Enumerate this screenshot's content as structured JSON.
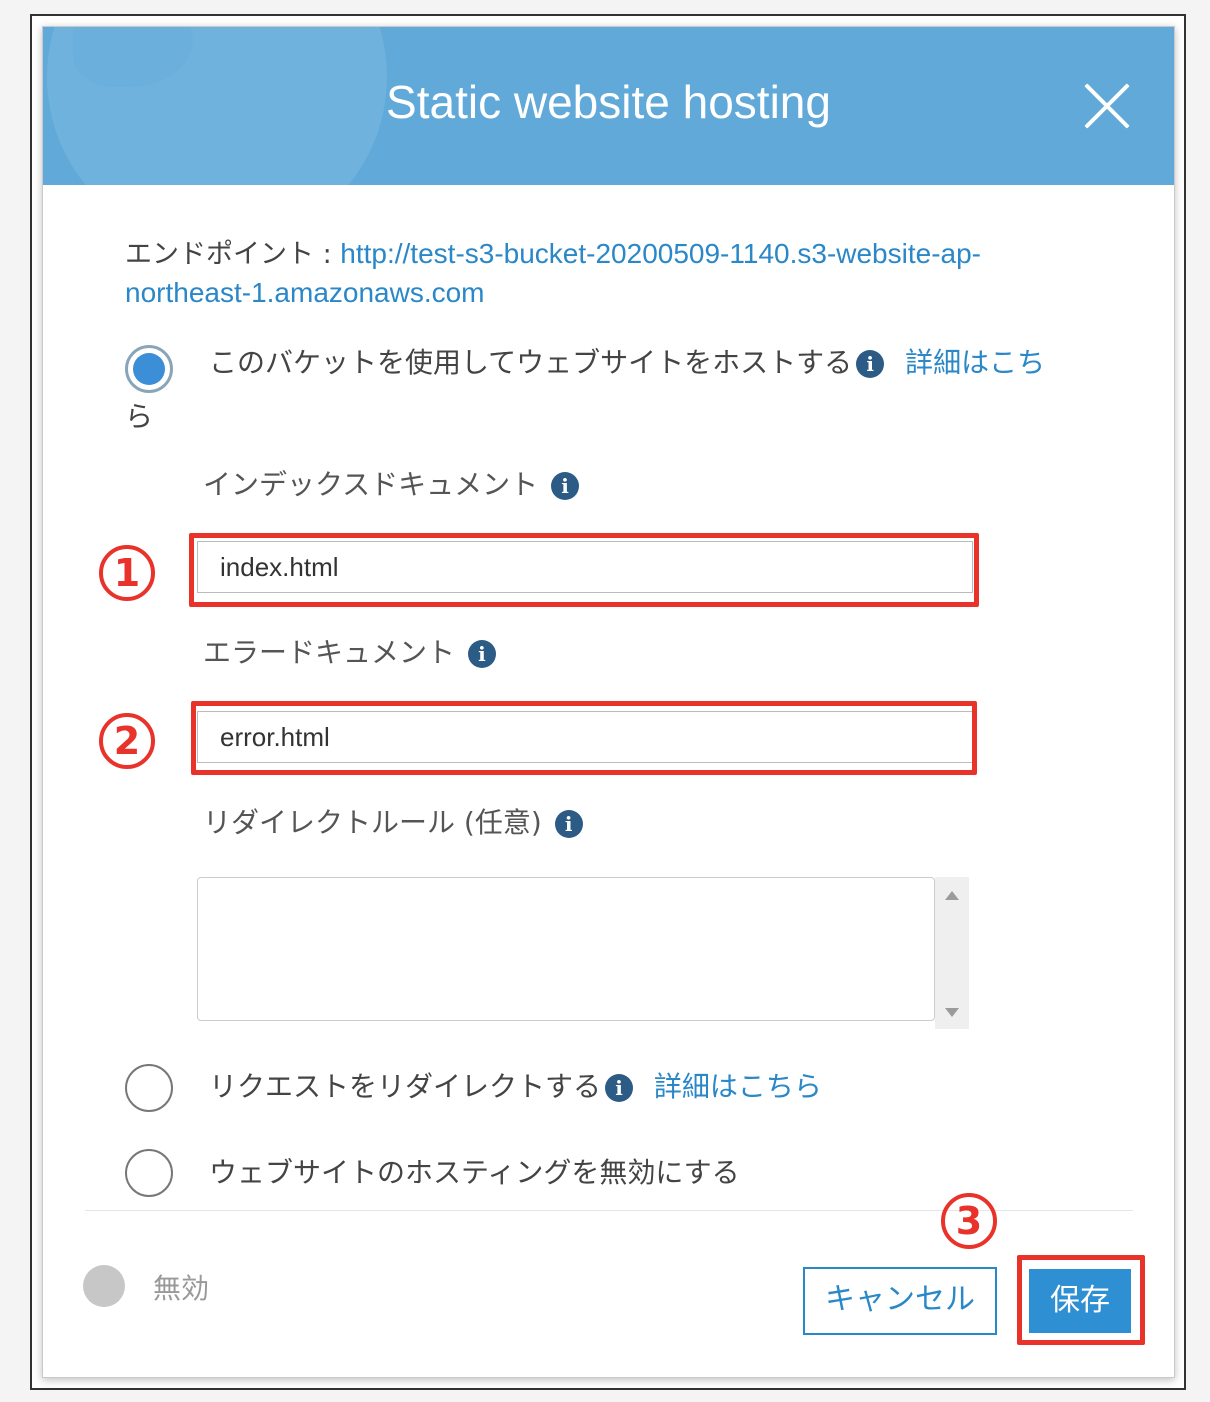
{
  "dialog": {
    "title": "Static website hosting",
    "close_icon": "close-icon"
  },
  "endpoint": {
    "label": "エンドポイント : ",
    "url_line1": "http://test-s3-bucket-20200509-1140.s3-website-ap-",
    "url_line2": "northeast-1.amazonaws.com"
  },
  "options": {
    "host": {
      "label": "このバケットを使用してウェブサイトをホストする",
      "link_line1": "詳細はこち",
      "link_line2": "ら",
      "checked": true
    },
    "redirect": {
      "label": "リクエストをリダイレクトする",
      "link": "詳細はこちら",
      "checked": false
    },
    "disable": {
      "label": "ウェブサイトのホスティングを無効にする",
      "checked": false
    }
  },
  "fields": {
    "index_label": "インデックスドキュメント",
    "index_value": "index.html",
    "error_label": "エラードキュメント",
    "error_value": "error.html",
    "redirect_rules_label": "リダイレクトルール (任意)",
    "redirect_rules_value": ""
  },
  "annotations": {
    "one": "1",
    "two": "2",
    "three": "3",
    "color": "#e8322a"
  },
  "footer": {
    "status_label": "無効",
    "cancel_label": "キャンセル",
    "save_label": "保存"
  },
  "colors": {
    "header": "#61a9d8",
    "link": "#2a87c8",
    "primary_button": "#2f8fd3",
    "info_icon": "#2c5b86"
  },
  "info_glyph": "i"
}
